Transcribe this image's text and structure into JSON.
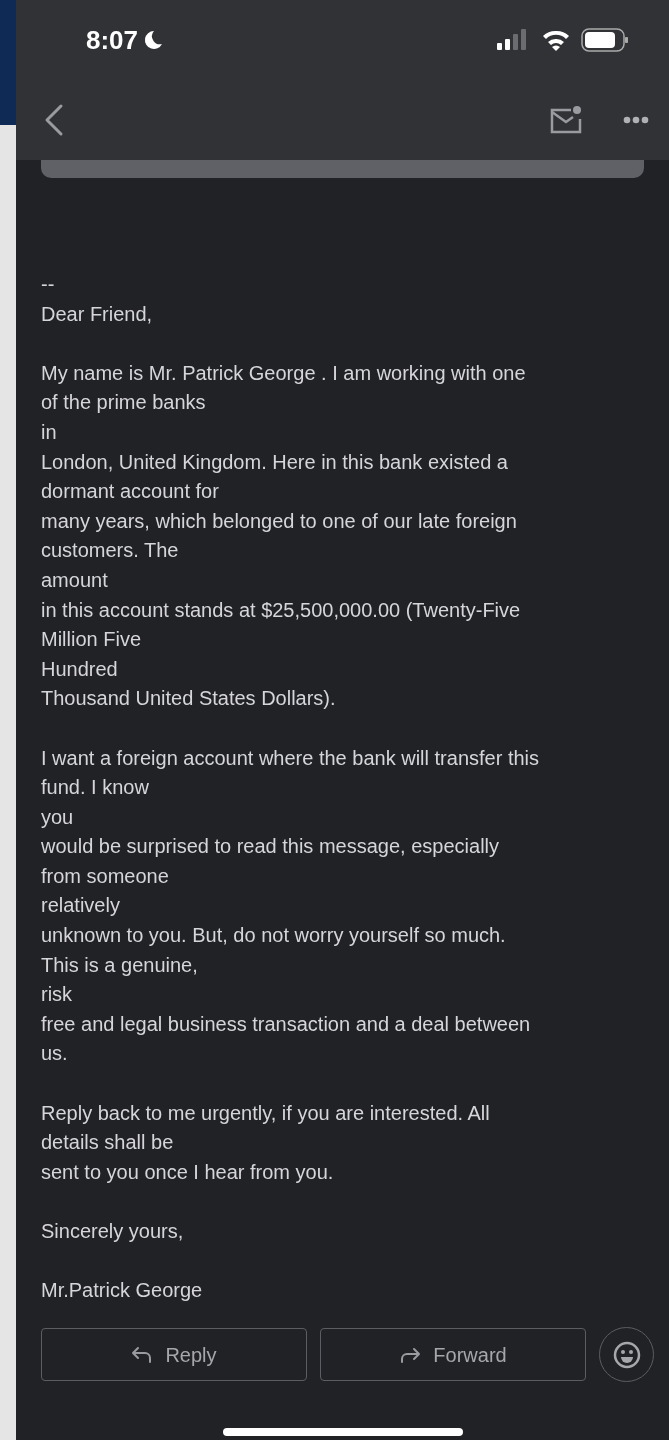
{
  "status_bar": {
    "time": "8:07"
  },
  "message": {
    "paragraphs": [
      [
        "--",
        "Dear Friend,"
      ],
      [
        "My name is Mr. Patrick George . I am working with one",
        "of the prime banks",
        "in",
        "London, United Kingdom. Here in this bank existed a",
        "dormant account for",
        "many years, which belonged to one of our late foreign",
        "customers. The",
        "amount",
        "in this account stands at $25,500,000.00 (Twenty-Five",
        "Million Five",
        "Hundred",
        "Thousand United States Dollars)."
      ],
      [
        "I want a foreign account where the bank will transfer this",
        "fund. I know",
        "you",
        "would be surprised to read this message, especially",
        "from someone",
        "relatively",
        "unknown to you. But, do not worry yourself so much.",
        "This is a genuine,",
        "risk",
        "free and legal business transaction and a deal between",
        "us."
      ],
      [
        "Reply back to me urgently, if you are interested. All",
        "details shall be",
        "sent to you once I hear from you."
      ],
      [
        "Sincerely yours,"
      ],
      [
        "Mr.Patrick George"
      ]
    ]
  },
  "actions": [
    {
      "kind": "reply",
      "label": "Reply"
    },
    {
      "kind": "forward",
      "label": "Forward"
    }
  ]
}
